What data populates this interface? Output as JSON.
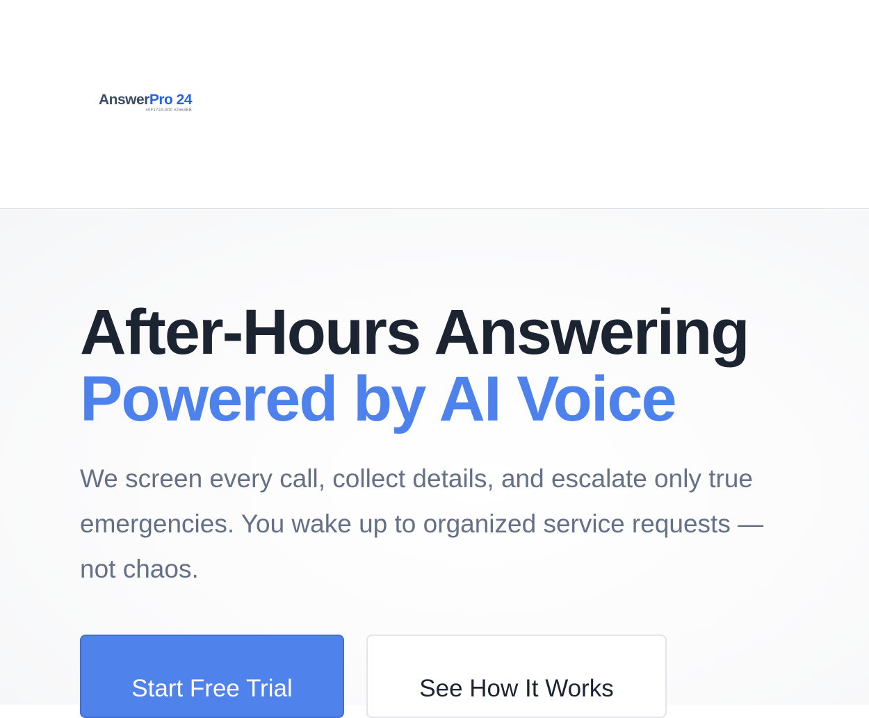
{
  "header": {
    "logo": {
      "word1": "Answer",
      "word2": "Pro 24",
      "sub": "#0F172A-900 #2563EB"
    }
  },
  "hero": {
    "title_line1": "After-Hours Answering",
    "title_line2": "Powered by AI Voice",
    "subtitle": "We screen every call, collect details, and escalate only true emergencies. You wake up to organized service requests — not chaos.",
    "primary_button": "Start Free Trial",
    "secondary_button": "See How It Works"
  },
  "colors": {
    "title_dark": "#1c2431",
    "accent_blue": "#4d82ec",
    "subtitle_gray": "#637086",
    "logo_blue": "#2563eb"
  }
}
